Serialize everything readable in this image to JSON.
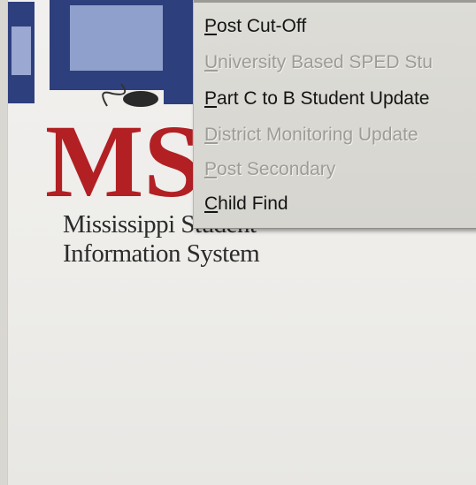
{
  "logo": {
    "letters": "MS",
    "tagline_line1": "Mississippi Student",
    "tagline_line2": "Information System",
    "brand_color": "#b22024"
  },
  "menu": {
    "items": [
      {
        "accel": "P",
        "rest": "ost Cut-Off",
        "enabled": true
      },
      {
        "accel": "U",
        "rest": "niversity Based SPED Stu",
        "enabled": false
      },
      {
        "accel": "P",
        "rest": "art C to B Student Update",
        "enabled": true
      },
      {
        "accel": "D",
        "rest": "istrict Monitoring Update",
        "enabled": false
      },
      {
        "accel": "P",
        "rest": "ost Secondary",
        "enabled": false
      },
      {
        "accel": "C",
        "rest": "hild Find",
        "enabled": true
      }
    ]
  }
}
